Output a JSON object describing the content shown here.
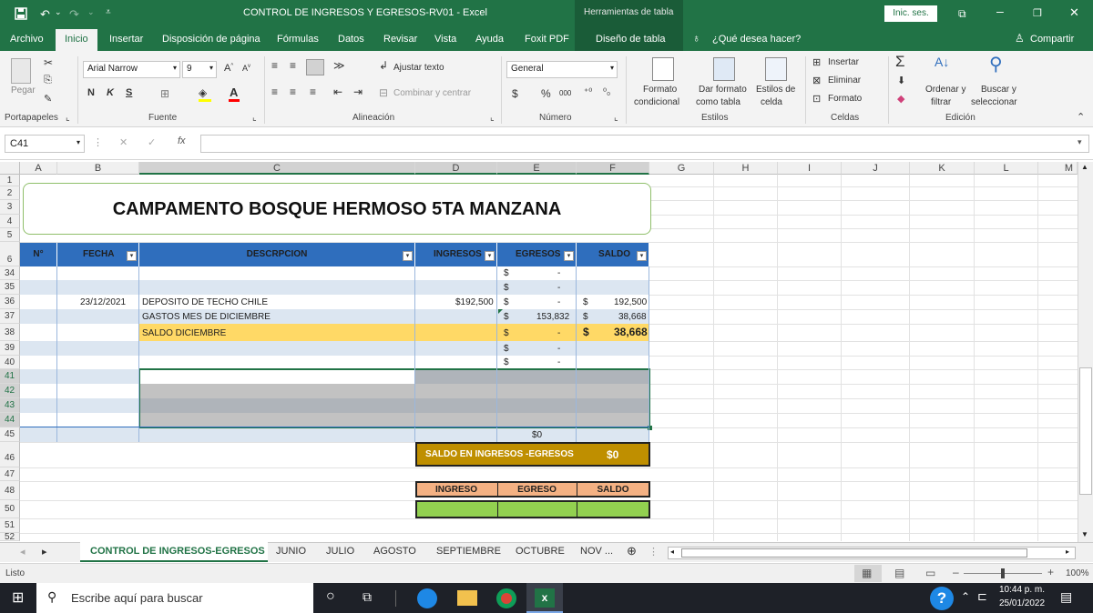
{
  "app": {
    "title": "CONTROL DE INGRESOS Y EGRESOS-RV01  -  Excel",
    "tools_context": "Herramientas de tabla",
    "signin": "Inic. ses.",
    "autosave_icons": [
      "save-icon",
      "undo-icon",
      "redo-icon"
    ]
  },
  "menu": {
    "tabs": [
      "Archivo",
      "Inicio",
      "Insertar",
      "Disposición de página",
      "Fórmulas",
      "Datos",
      "Revisar",
      "Vista",
      "Ayuda",
      "Foxit PDF",
      "Diseño de tabla"
    ],
    "active": "Inicio",
    "tellme": "¿Qué desea hacer?",
    "share": "Compartir"
  },
  "ribbon": {
    "clipboard": {
      "paste": "Pegar",
      "group": "Portapapeles"
    },
    "font": {
      "name": "Arial Narrow",
      "size": "9",
      "bold": "N",
      "italic": "K",
      "underline": "S",
      "group": "Fuente"
    },
    "alignment": {
      "wrap": "Ajustar texto",
      "merge": "Combinar y centrar",
      "group": "Alineación"
    },
    "number": {
      "format": "General",
      "currency": "$",
      "percent": "%",
      "thousands": "000",
      "group": "Número"
    },
    "styles": {
      "conditional": [
        "Formato",
        "condicional"
      ],
      "as_table": [
        "Dar formato",
        "como tabla"
      ],
      "cell_styles": [
        "Estilos de",
        "celda"
      ],
      "group": "Estilos"
    },
    "cells": {
      "insert": "Insertar",
      "delete": "Eliminar",
      "format": "Formato",
      "group": "Celdas"
    },
    "editing": {
      "sort": [
        "Ordenar y",
        "filtrar"
      ],
      "find": [
        "Buscar y",
        "seleccionar"
      ],
      "group": "Edición"
    }
  },
  "formula_bar": {
    "name_box": "C41",
    "formula": ""
  },
  "columns": [
    "A",
    "B",
    "C",
    "D",
    "E",
    "F",
    "G",
    "H",
    "I",
    "J",
    "K",
    "L",
    "M"
  ],
  "rows": [
    "1",
    "2",
    "3",
    "4",
    "5",
    "6",
    "34",
    "35",
    "36",
    "37",
    "38",
    "39",
    "40",
    "41",
    "42",
    "43",
    "44",
    "45",
    "46",
    "47",
    "48",
    "50",
    "51",
    "52"
  ],
  "sheet": {
    "banner": "CAMPAMENTO BOSQUE HERMOSO 5TA MANZANA",
    "headers": {
      "num": "N°",
      "fecha": "FECHA",
      "descripcion": "DESCRPCION",
      "ingresos": "INGRESOS",
      "egresos": "EGRESOS",
      "saldo": "SALDO"
    },
    "cur": "$",
    "dash": "-",
    "r36": {
      "fecha": "23/12/2021",
      "desc": "DEPOSITO DE TECHO CHILE",
      "ingreso": "$192,500",
      "saldo": "192,500"
    },
    "r37": {
      "desc": "GASTOS MES DE DICIEMBRE",
      "egreso": "153,832",
      "saldo": "38,668"
    },
    "r38": {
      "desc": "SALDO DICIEMBRE",
      "saldo": "38,668"
    },
    "r45": {
      "egresos_total": "$0"
    },
    "summary": {
      "label": "SALDO EN INGRESOS -EGRESOS",
      "value": "$0"
    },
    "summary2": {
      "ingreso": "INGRESO",
      "egreso": "EGRESO",
      "saldo": "SALDO"
    }
  },
  "sheet_tabs": [
    "CONTROL DE INGRESOS-EGRESOS",
    "JUNIO",
    "JULIO",
    "AGOSTO",
    "SEPTIEMBRE",
    "OCTUBRE",
    "NOV ..."
  ],
  "status": {
    "ready": "Listo",
    "zoom": "100%"
  },
  "taskbar": {
    "search": "Escribe aquí para buscar",
    "time": "10:44 p. m.",
    "date": "25/01/2022"
  },
  "colors": {
    "excel_green": "#217346",
    "table_header": "#2f6ebd",
    "band": "#dce6f1",
    "highlight": "#ffd966",
    "gold": "#bf8f00",
    "salmon": "#f4b183",
    "lime": "#92d050"
  }
}
